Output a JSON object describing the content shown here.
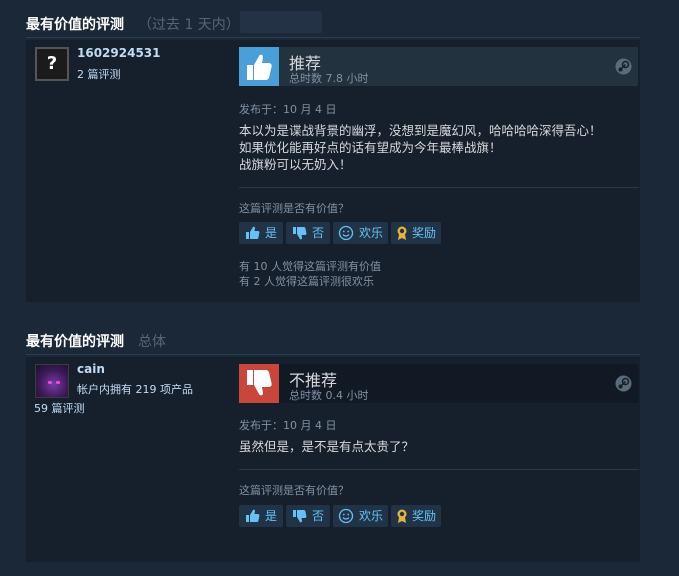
{
  "sections": [
    {
      "title": "最有价值的评测",
      "subtitle": "（过去 1 天内）",
      "review": {
        "author": "1602924531",
        "author_meta": [
          "2 篇评测"
        ],
        "verdict": "推荐",
        "hours": "总时数 7.8 小时",
        "posted": "发布于：10 月 4 日",
        "text_lines": [
          "本以为是谍战背景的幽浮，没想到是魔幻风，哈哈哈哈深得吾心！",
          "如果优化能再好点的话有望成为今年最棒战旗！",
          "战旗粉可以无奶入！"
        ],
        "helpful_question": "这篇评测是否有价值？",
        "buttons": {
          "yes": "是",
          "no": "否",
          "funny": "欢乐",
          "award": "奖励"
        },
        "counts": [
          "有 10 人觉得这篇评测有价值",
          "有 2 人觉得这篇评测很欢乐"
        ]
      }
    },
    {
      "title": "最有价值的评测",
      "subtitle": "总体",
      "review": {
        "author": "cain",
        "author_meta": [
          "帐户内拥有 219 项产品",
          "59 篇评测"
        ],
        "verdict": "不推荐",
        "hours": "总时数 0.4 小时",
        "posted": "发布于：10 月 4 日",
        "text_lines": [
          "虽然但是，是不是有点太贵了？"
        ],
        "helpful_question": "这篇评测是否有价值？",
        "buttons": {
          "yes": "是",
          "no": "否",
          "funny": "欢乐",
          "award": "奖励"
        }
      }
    }
  ],
  "colors": {
    "background": "#1b2838",
    "card": "#16202d",
    "link": "#67c1f5",
    "recommended": "#4a9fd8",
    "not_recommended": "#c8463b"
  },
  "icons": [
    "question-mark-avatar",
    "thumbs-up-icon",
    "thumbs-down-icon",
    "steam-icon",
    "smiley-icon",
    "award-icon"
  ]
}
